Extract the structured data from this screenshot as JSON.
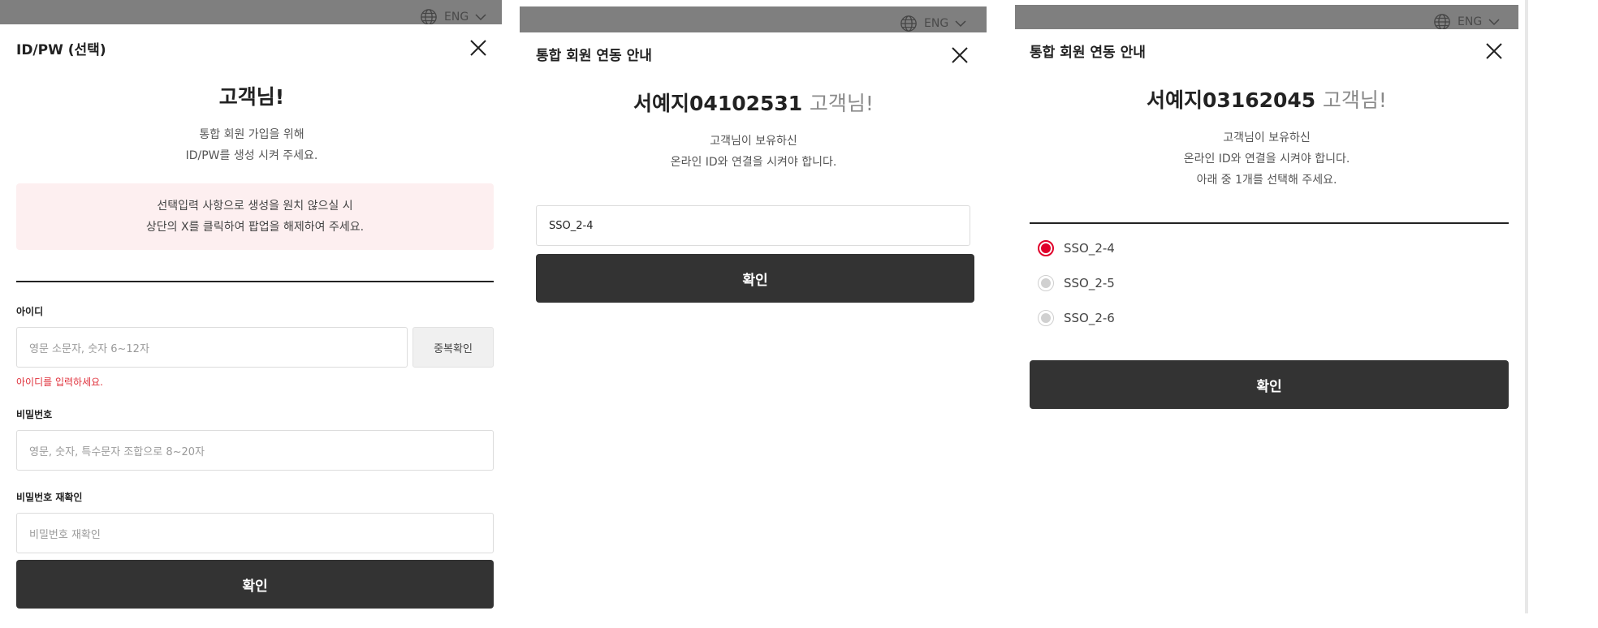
{
  "panels": [
    {
      "lang": {
        "label": "ENG"
      },
      "title": "ID/PW (선택)",
      "greeting": {
        "name": "고객님!",
        "suffix": ""
      },
      "desc": [
        "통합 회원 가입을 위해",
        "ID/PW를 생성 시켜 주세요."
      ],
      "notice": [
        "선택입력 사항으로 생성을 원치 않으실 시",
        "상단의 X를 클릭하여 팝업을 해제하여 주세요."
      ],
      "form": {
        "id_label": "아이디",
        "id_placeholder": "영문 소문자, 숫자 6~12자",
        "dup_button": "중복확인",
        "id_error": "아이디를 입력하세요.",
        "pw_label": "비밀번호",
        "pw_placeholder": "영문, 숫자, 특수문자 조합으로 8~20자",
        "pw2_label": "비밀번호 재확인",
        "pw2_placeholder": "비밀번호 재확인"
      },
      "confirm": "확인"
    },
    {
      "lang": {
        "label": "ENG"
      },
      "title": "통합 회원 연동 안내",
      "greeting": {
        "name": "서예지04102531",
        "suffix": "고객님!"
      },
      "desc": [
        "고객님이 보유하신",
        "온라인 ID와 연결을 시켜야 합니다."
      ],
      "id_value": "SSO_2-4",
      "confirm": "확인"
    },
    {
      "lang": {
        "label": "ENG"
      },
      "title": "통합 회원 연동 안내",
      "greeting": {
        "name": "서예지03162045",
        "suffix": "고객님!"
      },
      "desc": [
        "고객님이 보유하신",
        "온라인 ID와 연결을 시켜야 합니다.",
        "아래 중 1개를 선택해 주세요."
      ],
      "options": [
        {
          "label": "SSO_2-4",
          "selected": true
        },
        {
          "label": "SSO_2-5",
          "selected": false
        },
        {
          "label": "SSO_2-6",
          "selected": false
        }
      ],
      "confirm": "확인"
    }
  ],
  "colors": {
    "accent": "#e0002a",
    "button": "#333333",
    "overlay": "#7f7f7f",
    "notice_bg": "#fdeff0",
    "error": "#e0323c"
  }
}
